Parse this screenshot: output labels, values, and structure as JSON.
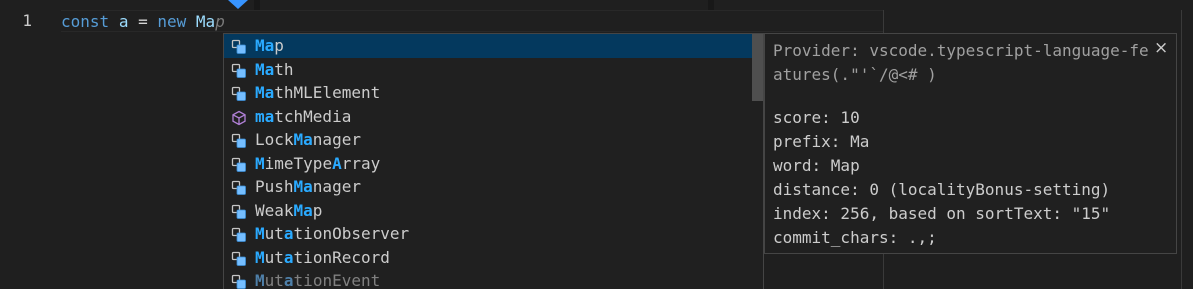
{
  "editor": {
    "line_number": "1",
    "code": {
      "kw_const": "const",
      "var_name": "a",
      "op_eq": "=",
      "kw_new": "new",
      "typed": "Ma",
      "ghost": "p"
    }
  },
  "suggest": {
    "items": [
      {
        "pre": "",
        "hl": "Ma",
        "mid": "p",
        "hl2": "",
        "post": "",
        "icon": "class-icon",
        "selected": true
      },
      {
        "pre": "",
        "hl": "Ma",
        "mid": "th",
        "hl2": "",
        "post": "",
        "icon": "class-icon"
      },
      {
        "pre": "",
        "hl": "Ma",
        "mid": "thMLElement",
        "hl2": "",
        "post": "",
        "icon": "class-icon"
      },
      {
        "pre": "",
        "hl": "ma",
        "mid": "tchMedia",
        "hl2": "",
        "post": "",
        "icon": "method-icon"
      },
      {
        "pre": "Lock",
        "hl": "Ma",
        "mid": "nager",
        "hl2": "",
        "post": "",
        "icon": "class-icon"
      },
      {
        "pre": "",
        "hl": "M",
        "mid": "imeType",
        "hl2": "A",
        "post": "rray",
        "icon": "class-icon"
      },
      {
        "pre": "Push",
        "hl": "Ma",
        "mid": "nager",
        "hl2": "",
        "post": "",
        "icon": "class-icon"
      },
      {
        "pre": "Weak",
        "hl": "Ma",
        "mid": "p",
        "hl2": "",
        "post": "",
        "icon": "class-icon"
      },
      {
        "pre": "",
        "hl": "M",
        "mid": "ut",
        "hl2": "a",
        "post": "tionObserver",
        "icon": "class-icon"
      },
      {
        "pre": "",
        "hl": "M",
        "mid": "ut",
        "hl2": "a",
        "post": "tionRecord",
        "icon": "class-icon"
      },
      {
        "pre": "",
        "hl": "M",
        "mid": "ut",
        "hl2": "a",
        "post": "tionEvent",
        "icon": "class-icon",
        "dim": true
      }
    ]
  },
  "details": {
    "provider": "Provider: vscode.typescript-language-features(.\"'`/@<# )",
    "close_glyph": "×",
    "lines": [
      "score: 10",
      "prefix: Ma",
      "word: Map",
      "distance: 0 (localityBonus-setting)",
      "index: 256, based on sortText: \"15\"",
      "commit_chars: .,;"
    ]
  },
  "colors": {
    "keyword": "#569cd6",
    "identifier": "#9cdcfe",
    "match_highlight": "#2aaaff",
    "selected_row": "#04395e",
    "class_icon": "#75beff",
    "method_icon": "#b180d7"
  }
}
